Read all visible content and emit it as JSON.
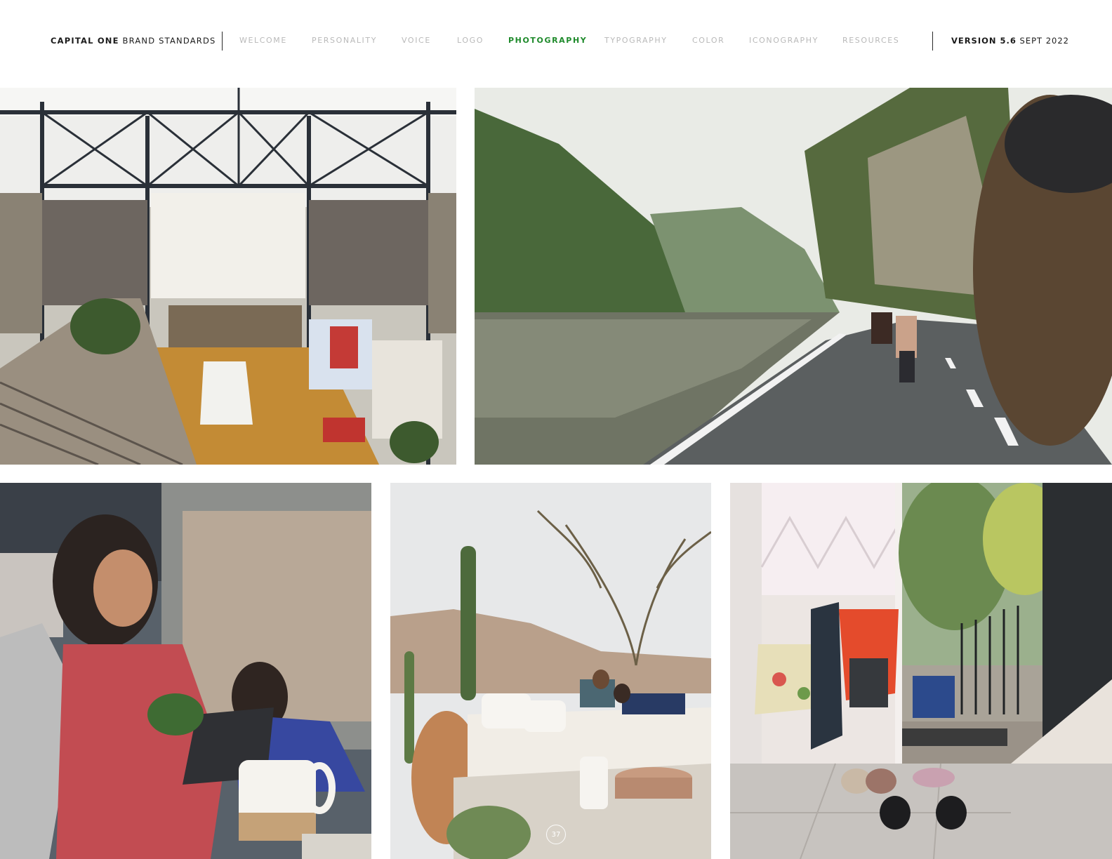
{
  "header": {
    "brand_bold": "CAPITAL ONE",
    "brand_rest": "BRAND STANDARDS",
    "nav": [
      {
        "label": "WELCOME",
        "active": false
      },
      {
        "label": "PERSONALITY",
        "active": false
      },
      {
        "label": "VOICE",
        "active": false
      },
      {
        "label": "LOGO",
        "active": false
      },
      {
        "label": "PHOTOGRAPHY",
        "active": true
      },
      {
        "label": "TYPOGRAPHY",
        "active": false
      },
      {
        "label": "COLOR",
        "active": false
      },
      {
        "label": "ICONOGRAPHY",
        "active": false
      },
      {
        "label": "RESOURCES",
        "active": false
      }
    ],
    "version_bold": "VERSION 5.6",
    "version_date": "SEPT 2022"
  },
  "colors": {
    "active_nav": "#1e8a2b",
    "inactive_nav": "#b9b9b9",
    "text": "#1b1b1b"
  },
  "photos": [
    {
      "subject": "office-atrium-photo"
    },
    {
      "subject": "mountain-road-scooter-photo"
    },
    {
      "subject": "cafe-woman-mug-photo"
    },
    {
      "subject": "desert-patio-couple-photo"
    },
    {
      "subject": "doorway-bags-shoes-photo"
    }
  ],
  "page_number": "37"
}
